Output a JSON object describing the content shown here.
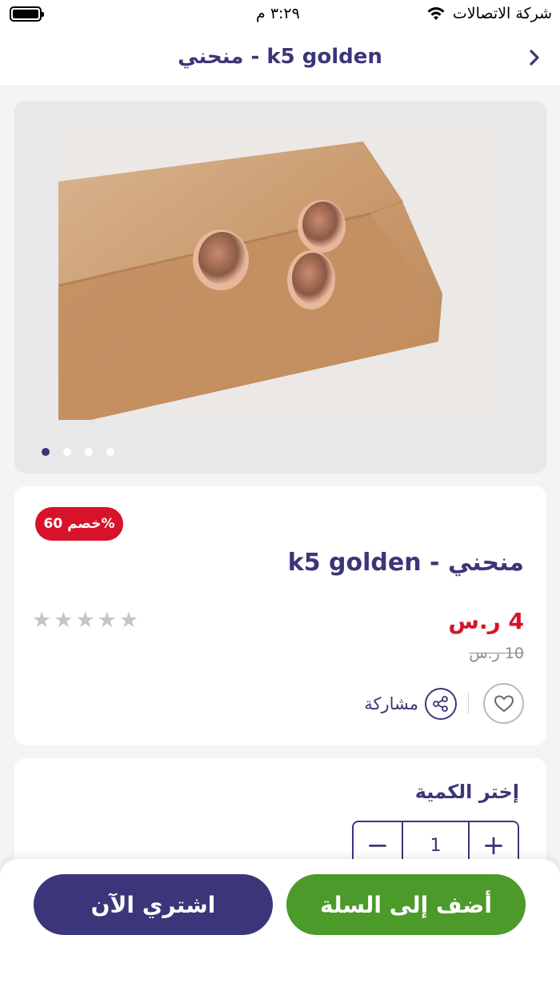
{
  "status_bar": {
    "time": "٣:٢٩ م",
    "carrier": "شركة الاتصالات",
    "icons": [
      "battery-icon",
      "wifi-icon"
    ]
  },
  "header": {
    "title": "منحني - k5 golden",
    "back_icon": "chevron-right-icon"
  },
  "gallery": {
    "image_alt": "rose gold stud earrings on wooden block",
    "slide_count": 4,
    "active_slide": 1
  },
  "product": {
    "discount_badge": "خصم 60%",
    "title": "منحني - k5 golden",
    "rating_stars": 5,
    "rating_value": 0,
    "price": "4 ر.س",
    "old_price": "10 ر.س",
    "share_label": "مشاركة",
    "icons": [
      "heart-icon",
      "share-icon",
      "star-icon"
    ]
  },
  "quantity": {
    "label": "إختر الكمية",
    "value": "1",
    "minus_label": "−",
    "plus_label": "+"
  },
  "actions": {
    "buy_now": "اشتري الآن",
    "add_to_cart": "أضف إلى السلة"
  },
  "colors": {
    "primary": "#3b3679",
    "accent_green": "#4c9a2a",
    "discount_red": "#d6132a"
  }
}
